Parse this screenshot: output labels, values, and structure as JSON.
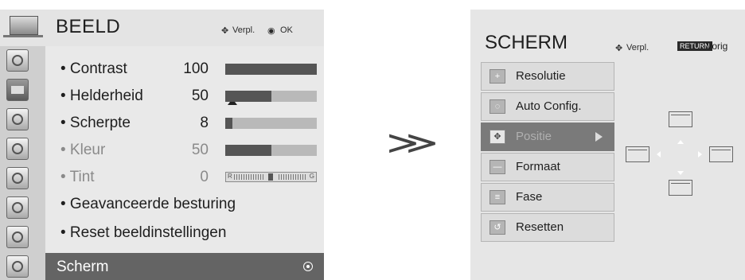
{
  "left": {
    "title": "BEELD",
    "hint_move": "Verpl.",
    "hint_ok": "OK",
    "items": [
      {
        "label": "• Contrast",
        "value": "100",
        "level": 100,
        "enabled": true
      },
      {
        "label": "• Helderheid",
        "value": "50",
        "level": 50,
        "enabled": true
      },
      {
        "label": "• Scherpte",
        "value": "8",
        "level": 8,
        "enabled": true
      },
      {
        "label": "• Kleur",
        "value": "50",
        "level": 50,
        "enabled": false
      },
      {
        "label": "• Tint",
        "value": "0",
        "enabled": false
      },
      {
        "label": "• Geavanceerde besturing",
        "enabled": true
      },
      {
        "label": "• Reset beeldinstellingen",
        "enabled": true
      }
    ],
    "tint": {
      "left_letter": "R",
      "right_letter": "G"
    },
    "selected_row": "Scherm",
    "side_icons": [
      "picture-icon",
      "tv-screen-icon",
      "speaker-icon",
      "clock-icon",
      "lock-icon",
      "lock-icon",
      "input-icon",
      "settings-icon"
    ]
  },
  "right": {
    "title": "SCHERM",
    "hint_move": "Verpl.",
    "return_badge": "RETURN",
    "return_label": "Vorig",
    "items": [
      {
        "label": "Resolutie",
        "icon": "+"
      },
      {
        "label": "Auto Config.",
        "icon": "◌"
      },
      {
        "label": "Positie",
        "icon": "✥",
        "selected": true
      },
      {
        "label": "Formaat",
        "icon": "—"
      },
      {
        "label": "Fase",
        "icon": "≡"
      },
      {
        "label": "Resetten",
        "icon": "↺"
      }
    ]
  },
  "arrow_glyph": "≫"
}
